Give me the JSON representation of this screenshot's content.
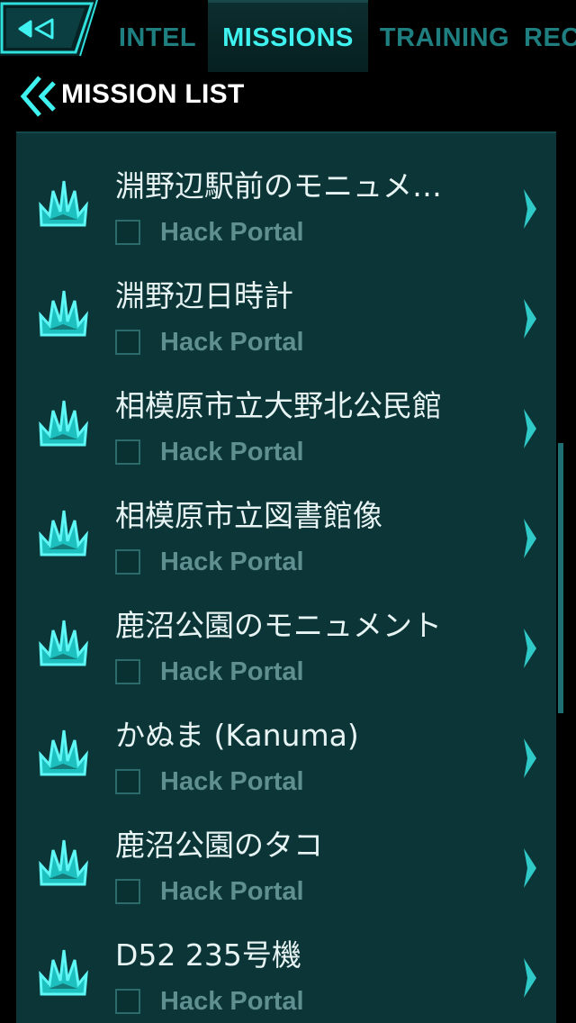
{
  "tabs": [
    {
      "label": "INTEL",
      "active": false
    },
    {
      "label": "MISSIONS",
      "active": true
    },
    {
      "label": "TRAINING",
      "active": false
    },
    {
      "label": "REC",
      "active": false
    }
  ],
  "header": {
    "title": "MISSION LIST"
  },
  "missions": [
    {
      "title": "淵野辺駅前のモニュメ…",
      "task": "Hack Portal",
      "done": false
    },
    {
      "title": "淵野辺日時計",
      "task": "Hack Portal",
      "done": false
    },
    {
      "title": "相模原市立大野北公民館",
      "task": "Hack Portal",
      "done": false
    },
    {
      "title": "相模原市立図書館像",
      "task": "Hack Portal",
      "done": false
    },
    {
      "title": "鹿沼公園のモニュメント",
      "task": "Hack Portal",
      "done": false
    },
    {
      "title": "かぬま (Kanuma)",
      "task": "Hack Portal",
      "done": false
    },
    {
      "title": "鹿沼公園のタコ",
      "task": "Hack Portal",
      "done": false
    },
    {
      "title": "D52 235号機",
      "task": "Hack Portal",
      "done": false
    }
  ],
  "icons": {
    "back": "back-arrow-icon",
    "header": "double-chevron-left-icon",
    "mission": "portal-hack-burst-icon",
    "row_chevron": "chevron-right-icon"
  },
  "colors": {
    "accent": "#3ff2ef",
    "inactive_tab": "#1f7f80",
    "panel": "#0b3536",
    "task_text": "#5f8f90"
  }
}
